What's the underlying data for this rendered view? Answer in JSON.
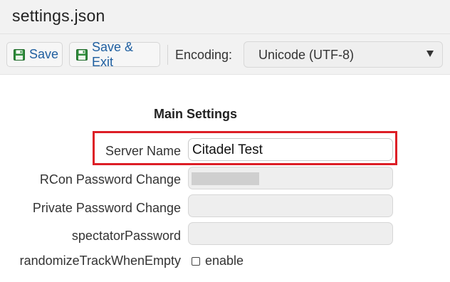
{
  "window": {
    "title": "settings.json"
  },
  "toolbar": {
    "save_label": "Save",
    "save_exit_label": "Save & Exit",
    "encoding_label": "Encoding:",
    "encoding_value": "Unicode (UTF-8)",
    "save_icon": "floppy-disk-icon",
    "caret_icon": "dropdown-caret-icon"
  },
  "main": {
    "section_title": "Main Settings",
    "fields": [
      {
        "label": "Server Name",
        "value": "Citadel Test"
      },
      {
        "label": "RCon Password Change",
        "value": ""
      },
      {
        "label": "Private Password Change",
        "value": ""
      },
      {
        "label": "spectatorPassword",
        "value": ""
      }
    ],
    "randomize": {
      "label": "randomizeTrackWhenEmpty",
      "checkbox_label": "enable",
      "checked": false
    }
  },
  "colors": {
    "highlight": "#dd1e26",
    "toolbar_link": "#1f5fa0",
    "save_icon_green": "#2e8b3a"
  }
}
